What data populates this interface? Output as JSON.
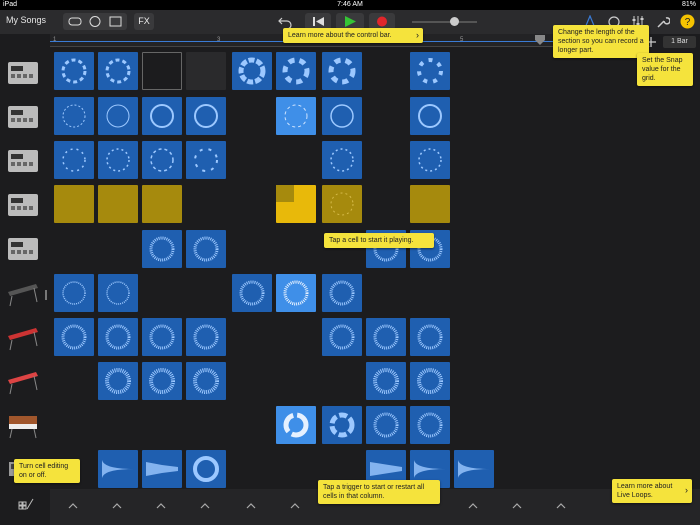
{
  "status": {
    "device": "iPad",
    "time": "7:46 AM",
    "battery": "81%"
  },
  "toolbar": {
    "my_songs": "My Songs",
    "fx": "FX",
    "bar_length": "1 Bar"
  },
  "ruler": {
    "ticks": [
      "1",
      "3",
      "5"
    ]
  },
  "tooltips": {
    "control_bar": "Learn more about the control bar.",
    "section_length": "Change the length of the section so you can record a longer part.",
    "snap": "Set the Snap value for the grid.",
    "tap_cell": "Tap a cell to start it playing.",
    "cell_editing": "Turn cell editing on or off.",
    "trigger": "Tap a trigger to start or restart all cells in that column.",
    "live_loops": "Learn more about Live Loops."
  },
  "tracks": [
    "drum-machine",
    "drum-machine",
    "drum-machine",
    "drum-machine",
    "drum-machine",
    "keyboard",
    "keyboard",
    "keyboard",
    "synth",
    "synth"
  ],
  "colors": {
    "accent": "#3a7bd5",
    "cell_blue": "#1f5fb0",
    "cell_yellow": "#a68a0d",
    "tooltip": "#f5e33c"
  }
}
